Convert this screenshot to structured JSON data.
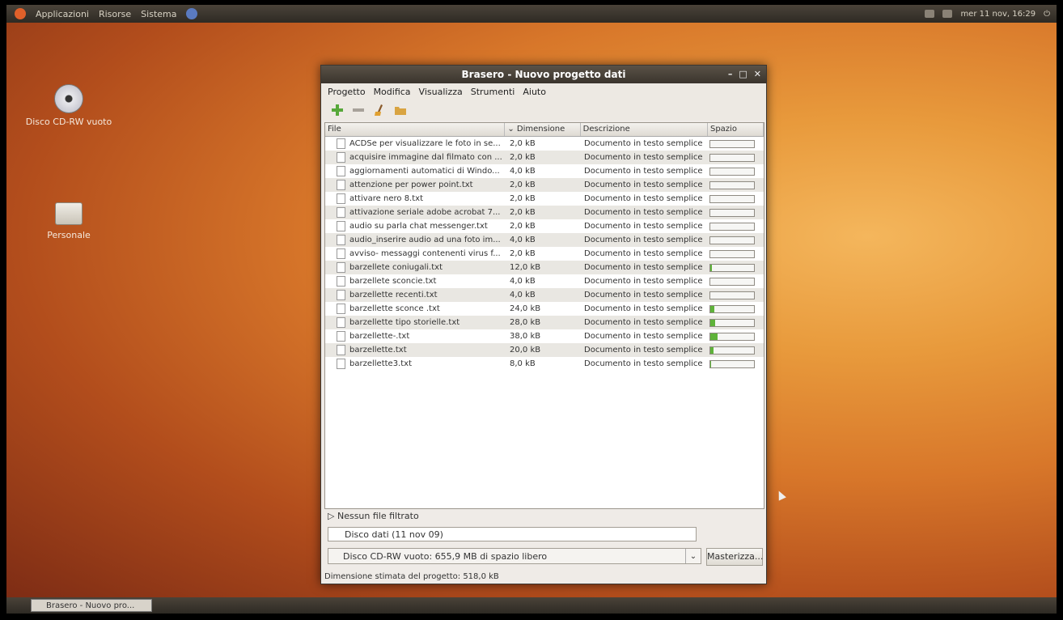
{
  "topbar": {
    "menus": [
      "Applicazioni",
      "Risorse",
      "Sistema"
    ],
    "clock": "mer 11 nov, 16:29"
  },
  "desktop": {
    "icons": [
      {
        "label": "Disco CD-RW vuoto",
        "icon": "cd-rw-icon"
      },
      {
        "label": "Personale",
        "icon": "home-folder-icon"
      }
    ]
  },
  "window": {
    "title": "Brasero - Nuovo progetto dati",
    "menu": [
      "Progetto",
      "Modifica",
      "Visualizza",
      "Strumenti",
      "Aiuto"
    ],
    "toolbar": [
      "add-icon",
      "remove-icon",
      "clear-icon",
      "folder-icon"
    ],
    "columns": [
      "File",
      "Dimensione",
      "Descrizione",
      "Spazio"
    ],
    "files": [
      {
        "name": "ACDSe per visualizzare le foto in se...",
        "size": "2,0 kB",
        "desc": "Documento in testo semplice",
        "space": 0.0
      },
      {
        "name": "acquisire immagine dal filmato con ...",
        "size": "2,0 kB",
        "desc": "Documento in testo semplice",
        "space": 0.0
      },
      {
        "name": "aggiornamenti automatici di Windo...",
        "size": "4,0 kB",
        "desc": "Documento in testo semplice",
        "space": 0.0
      },
      {
        "name": "attenzione per power point.txt",
        "size": "2,0 kB",
        "desc": "Documento in testo semplice",
        "space": 0.0
      },
      {
        "name": "attivare nero 8.txt",
        "size": "2,0 kB",
        "desc": "Documento in testo semplice",
        "space": 0.0
      },
      {
        "name": "attivazione seriale adobe acrobat 7...",
        "size": "2,0 kB",
        "desc": "Documento in testo semplice",
        "space": 0.0
      },
      {
        "name": "audio su parla chat messenger.txt",
        "size": "2,0 kB",
        "desc": "Documento in testo semplice",
        "space": 0.0
      },
      {
        "name": "audio_inserire audio ad una foto im...",
        "size": "4,0 kB",
        "desc": "Documento in testo semplice",
        "space": 0.0
      },
      {
        "name": "avviso- messaggi contenenti virus f...",
        "size": "2,0 kB",
        "desc": "Documento in testo semplice",
        "space": 0.0
      },
      {
        "name": "barzellete coniugali.txt",
        "size": "12,0 kB",
        "desc": "Documento in testo semplice",
        "space": 0.04
      },
      {
        "name": "barzellete sconcie.txt",
        "size": "4,0 kB",
        "desc": "Documento in testo semplice",
        "space": 0.0
      },
      {
        "name": "barzellette recenti.txt",
        "size": "4,0 kB",
        "desc": "Documento in testo semplice",
        "space": 0.0
      },
      {
        "name": "barzellette sconce .txt",
        "size": "24,0 kB",
        "desc": "Documento in testo semplice",
        "space": 0.1
      },
      {
        "name": "barzellette tipo storielle.txt",
        "size": "28,0 kB",
        "desc": "Documento in testo semplice",
        "space": 0.11
      },
      {
        "name": "barzellette-.txt",
        "size": "38,0 kB",
        "desc": "Documento in testo semplice",
        "space": 0.16
      },
      {
        "name": "barzellette.txt",
        "size": "20,0 kB",
        "desc": "Documento in testo semplice",
        "space": 0.08
      },
      {
        "name": "barzellette3.txt",
        "size": "8,0 kB",
        "desc": "Documento in testo semplice",
        "space": 0.02
      }
    ],
    "filter_label": "Nessun file filtrato",
    "disc_name": "Disco dati (11 nov 09)",
    "disc_select": "Disco CD-RW vuoto: 655,9 MB di spazio libero",
    "burn_label": "Masterizza...",
    "status": "Dimensione stimata del progetto: 518,0 kB"
  },
  "taskbar": {
    "task": "Brasero - Nuovo pro..."
  }
}
